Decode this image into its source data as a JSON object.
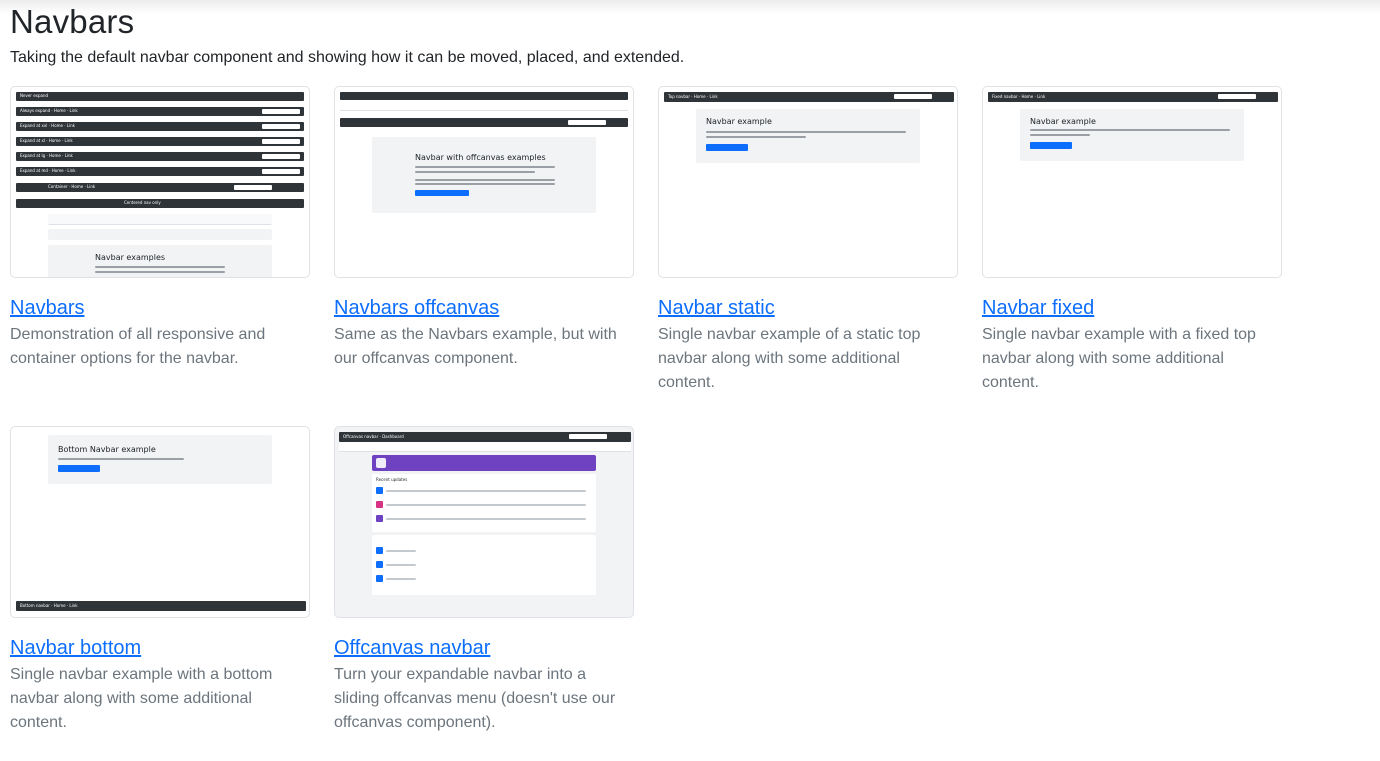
{
  "page": {
    "title": "Navbars",
    "subtitle": "Taking the default navbar component and showing how it can be moved, placed, and extended."
  },
  "cards": [
    {
      "title": "Navbars",
      "description": "Demonstration of all responsive and container options for the navbar.",
      "thumb_text": "Navbar examples"
    },
    {
      "title": "Navbars offcanvas",
      "description": "Same as the Navbars example, but with our offcanvas component.",
      "thumb_text": "Navbar with offcanvas examples"
    },
    {
      "title": "Navbar static",
      "description": "Single navbar example of a static top navbar along with some additional content.",
      "thumb_text": "Navbar example"
    },
    {
      "title": "Navbar fixed",
      "description": "Single navbar example with a fixed top navbar along with some additional content.",
      "thumb_text": "Navbar example"
    },
    {
      "title": "Navbar bottom",
      "description": "Single navbar example with a bottom navbar along with some additional content.",
      "thumb_text": "Bottom Navbar example"
    },
    {
      "title": "Offcanvas navbar",
      "description": "Turn your expandable navbar into a sliding offcanvas menu (doesn't use our offcanvas component).",
      "thumb_text": "Recent updates"
    }
  ],
  "colors": {
    "link": "#0d6efd",
    "muted": "#6c757d",
    "navbar_dark": "#2f3439",
    "panel_bg": "#f1f3f5",
    "offcanvas_purple": "#6f42c1"
  }
}
